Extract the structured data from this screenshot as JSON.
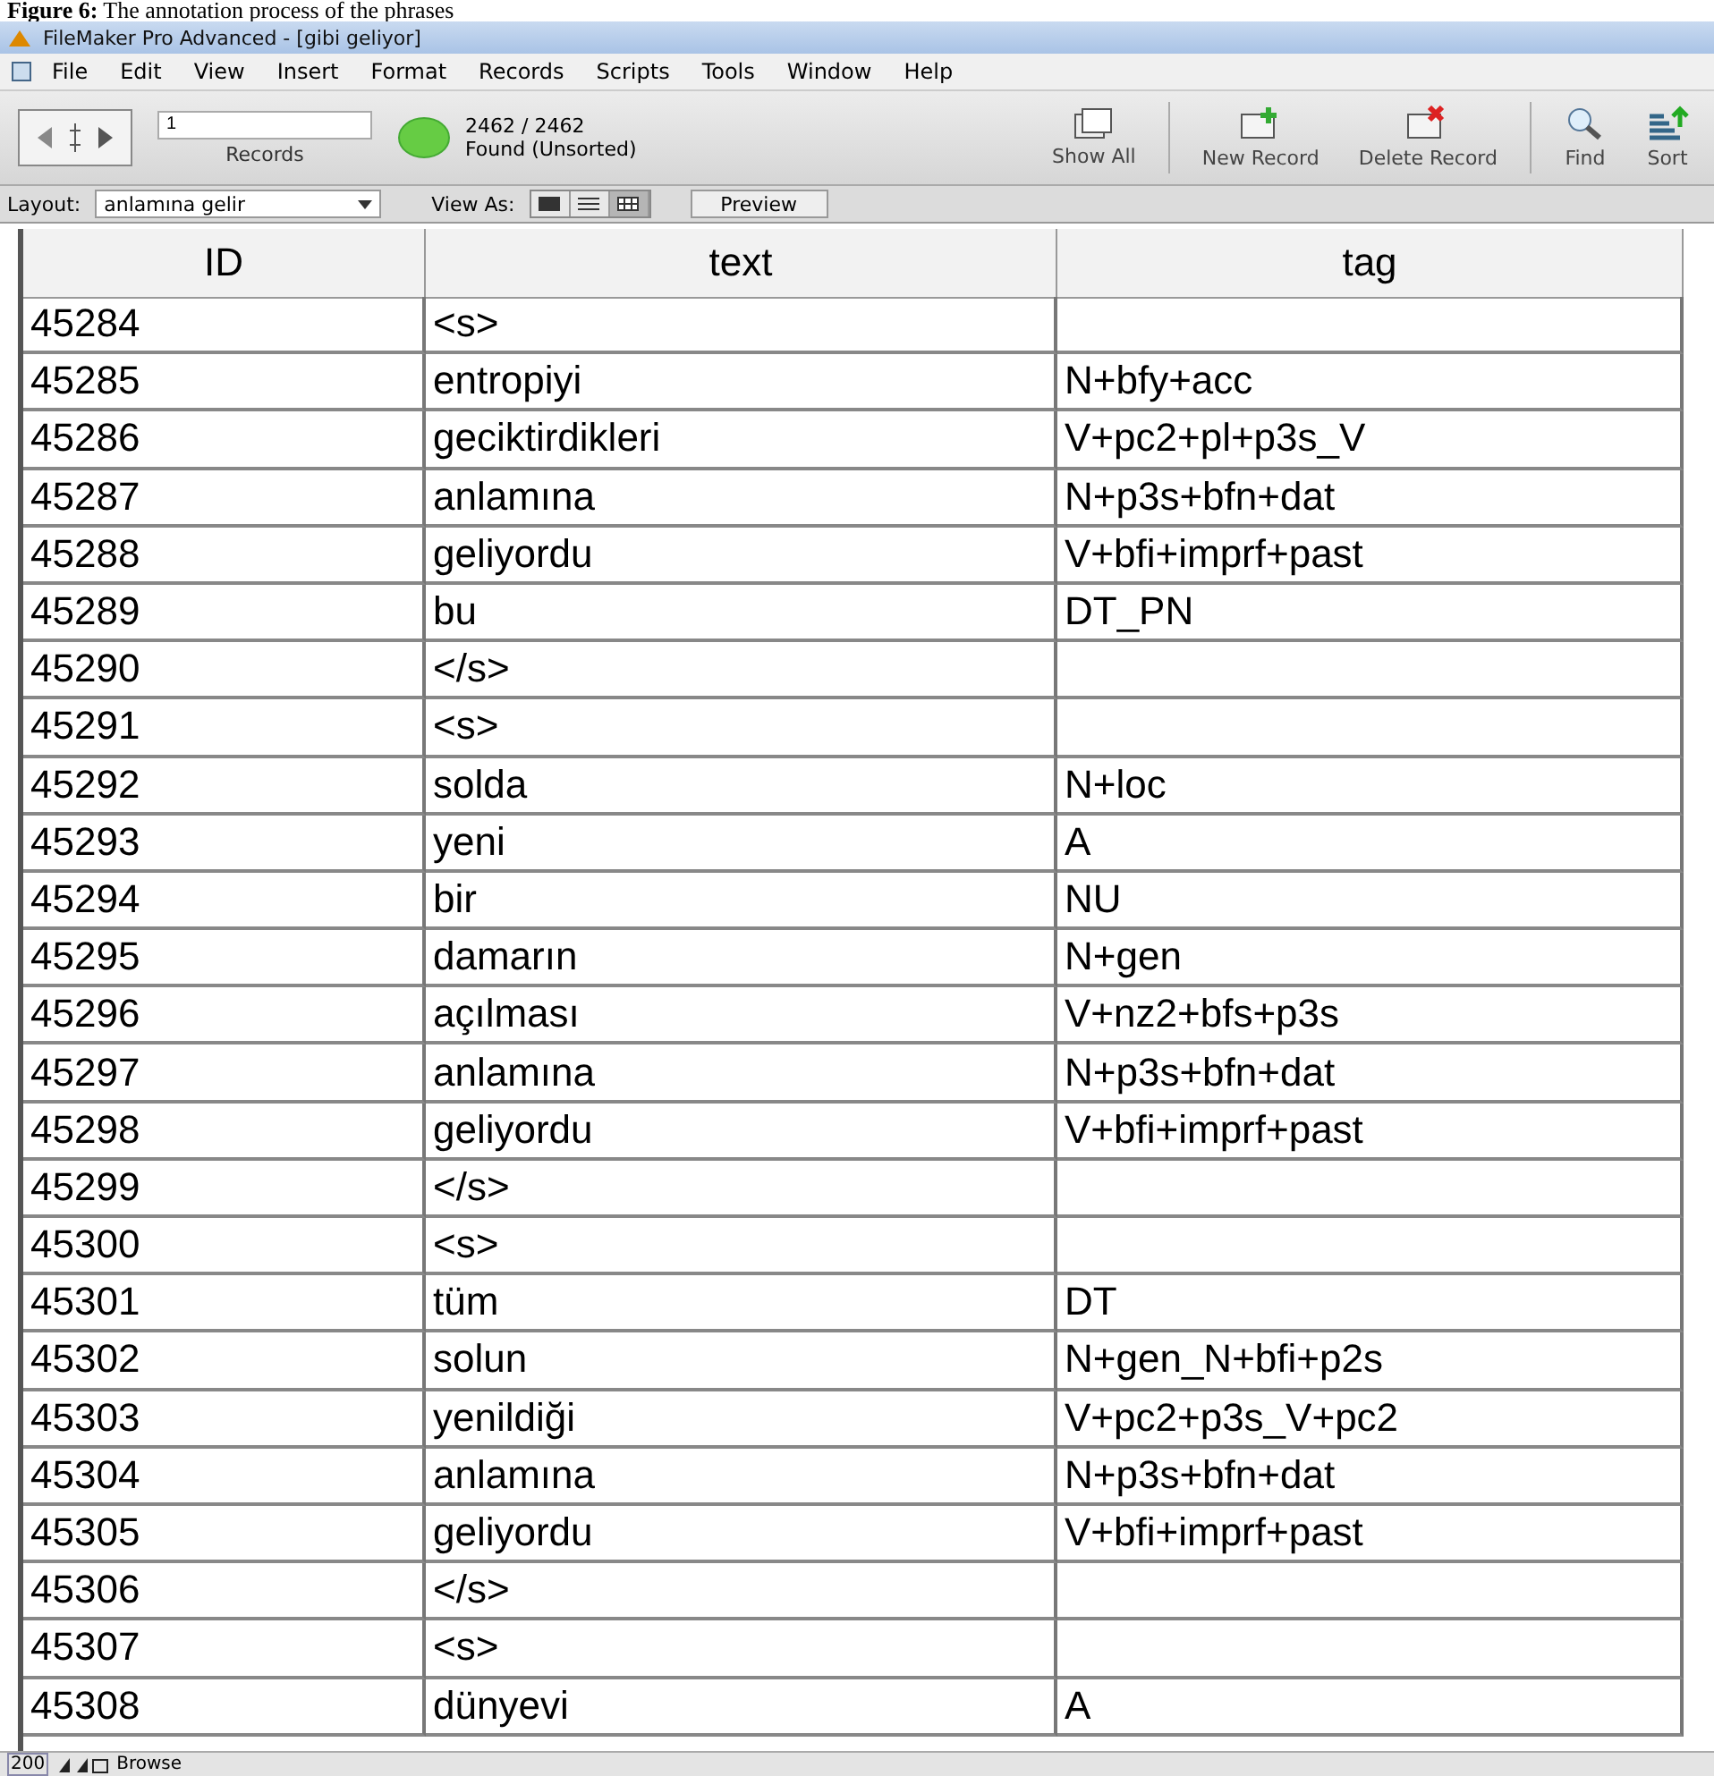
{
  "caption": "**Figure 6:** The annotation process of the phrases",
  "window": {
    "title": "FileMaker Pro Advanced - [gibi geliyor]"
  },
  "menu": [
    "File",
    "Edit",
    "View",
    "Insert",
    "Format",
    "Records",
    "Scripts",
    "Tools",
    "Window",
    "Help"
  ],
  "toolbar": {
    "record_field": "1",
    "records_label": "Records",
    "found_count": "2462 / 2462",
    "found_status": "Found (Unsorted)",
    "buttons": [
      {
        "label": "Show All",
        "kind": "showall"
      },
      {
        "label": "New Record",
        "kind": "new"
      },
      {
        "label": "Delete Record",
        "kind": "delete"
      },
      {
        "label": "Find",
        "kind": "find"
      },
      {
        "label": "Sort",
        "kind": "sort"
      }
    ]
  },
  "layout_bar": {
    "layout_label": "Layout:",
    "layout_value": "anlamına gelir",
    "view_as_label": "View As:",
    "view_modes": [
      {
        "kind": "form",
        "selected": false
      },
      {
        "kind": "list",
        "selected": false
      },
      {
        "kind": "table",
        "selected": true
      }
    ],
    "preview": "Preview"
  },
  "table": {
    "columns": [
      "ID",
      "text",
      "tag"
    ],
    "rows": [
      [
        "45284",
        "<s>",
        ""
      ],
      [
        "45285",
        "entropiyi",
        "N+bfy+acc"
      ],
      [
        "45286",
        "geciktirdikleri",
        "V+pc2+pl+p3s_V"
      ],
      [
        "45287",
        "anlamına",
        "N+p3s+bfn+dat"
      ],
      [
        "45288",
        "geliyordu",
        "V+bfi+imprf+past"
      ],
      [
        "45289",
        "bu",
        "DT_PN"
      ],
      [
        "45290",
        "</s>",
        ""
      ],
      [
        "45291",
        "<s>",
        ""
      ],
      [
        "45292",
        "solda",
        "N+loc"
      ],
      [
        "45293",
        "yeni",
        "A"
      ],
      [
        "45294",
        "bir",
        "NU"
      ],
      [
        "45295",
        "damarın",
        "N+gen"
      ],
      [
        "45296",
        "açılması",
        "V+nz2+bfs+p3s"
      ],
      [
        "45297",
        "anlamına",
        "N+p3s+bfn+dat"
      ],
      [
        "45298",
        "geliyordu",
        "V+bfi+imprf+past"
      ],
      [
        "45299",
        "</s>",
        ""
      ],
      [
        "45300",
        "<s>",
        ""
      ],
      [
        "45301",
        "tüm",
        "DT"
      ],
      [
        "45302",
        "solun",
        "N+gen_N+bfi+p2s"
      ],
      [
        "45303",
        "yenildiği",
        "V+pc2+p3s_V+pc2"
      ],
      [
        "45304",
        "anlamına",
        "N+p3s+bfn+dat"
      ],
      [
        "45305",
        "geliyordu",
        "V+bfi+imprf+past"
      ],
      [
        "45306",
        "</s>",
        ""
      ],
      [
        "45307",
        "<s>",
        ""
      ],
      [
        "45308",
        "dünyevi",
        "A"
      ]
    ]
  },
  "status_bar": {
    "zoom": "200",
    "mode": "Browse"
  }
}
